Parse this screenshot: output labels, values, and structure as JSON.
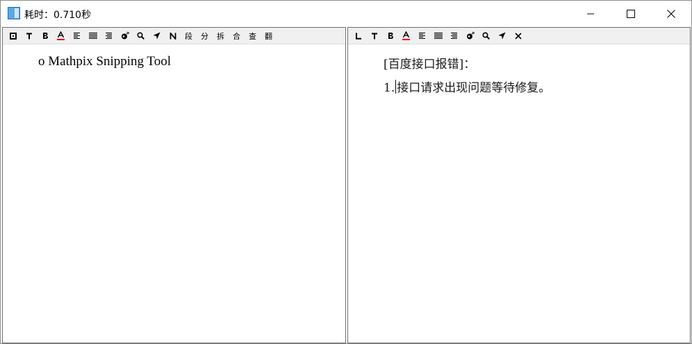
{
  "window": {
    "title": "耗时：0.710秒"
  },
  "left_toolbar": {
    "seg": "段",
    "split": "分",
    "separate": "拆",
    "merge": "合",
    "lookup": "查",
    "translate": "翻"
  },
  "left_text": {
    "line1": "o Mathpix Snipping Tool"
  },
  "right_text": {
    "line1": "[百度接口报错]：",
    "line2_prefix": "1.",
    "line2_rest": "接口请求出现问题等待修复。"
  },
  "colors": {
    "accent_red": "#e00000",
    "icon_blue": "#3a8fd6"
  }
}
